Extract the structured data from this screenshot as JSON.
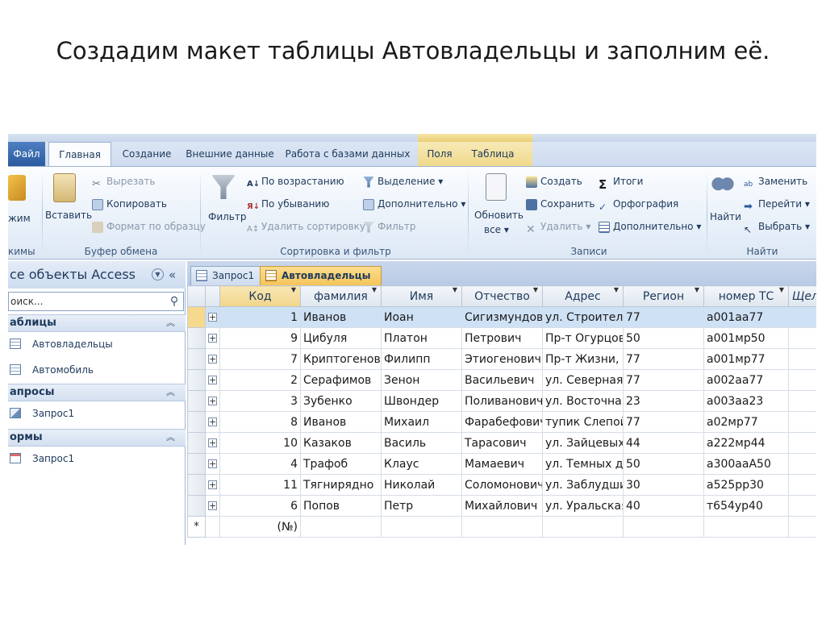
{
  "slide": {
    "title": "Создадим макет таблицы Автовладельцы и заполним её."
  },
  "ribbon": {
    "tabs": [
      "Файл",
      "Главная",
      "Создание",
      "Внешние данные",
      "Работа с базами данных",
      "Поля",
      "Таблица"
    ],
    "views": {
      "label": "жим",
      "group": "кимы"
    },
    "clipboard": {
      "paste": "Вставить",
      "cut": "Вырезать",
      "copy": "Копировать",
      "format_painter": "Формат по образцу",
      "group": "Буфер обмена"
    },
    "sort_filter": {
      "filter": "Фильтр",
      "ascending": "По возрастанию",
      "descending": "По убыванию",
      "remove_sort": "Удалить сортировку",
      "selection": "Выделение",
      "advanced": "Дополнительно",
      "toggle_filter": "Фильтр",
      "group": "Сортировка и фильтр"
    },
    "records": {
      "refresh": "Обновить",
      "refresh_sub": "все",
      "new": "Создать",
      "save": "Сохранить",
      "delete": "Удалить",
      "totals": "Итоги",
      "spelling": "Орфография",
      "more": "Дополнительно",
      "group": "Записи"
    },
    "find": {
      "find": "Найти",
      "replace": "Заменить",
      "goto": "Перейти",
      "select": "Выбрать",
      "group": "Найти"
    }
  },
  "nav": {
    "header": "се объекты Access",
    "search_placeholder": "оиск...",
    "sections": [
      {
        "label": "аблицы",
        "items": [
          "Автовладельцы",
          "Автомобиль"
        ]
      },
      {
        "label": "апросы",
        "items": [
          "Запрос1"
        ]
      },
      {
        "label": "ормы",
        "items": [
          "Запрос1"
        ]
      }
    ]
  },
  "doc_tabs": [
    "Запрос1",
    "Автовладельцы"
  ],
  "table": {
    "columns": [
      "Код",
      "фамилия",
      "Имя",
      "Отчество",
      "Адрес",
      "Регион",
      "номер ТС",
      "Щелк"
    ],
    "rows": [
      [
        "1",
        "Иванов",
        "Иоан",
        "Сигизмундови",
        "ул. Строителе",
        "77",
        "а001аа77"
      ],
      [
        "9",
        "Цибуля",
        "Платон",
        "Петрович",
        "Пр-т Огурцов",
        "50",
        "а001мр50"
      ],
      [
        "7",
        "Криптогенов",
        "Филипп",
        "Этиогенович",
        "Пр-т Жизни, 1",
        "77",
        "а001мр77"
      ],
      [
        "2",
        "Серафимов",
        "Зенон",
        "Васильевич",
        "ул. Северная,",
        "77",
        "а002аа77"
      ],
      [
        "3",
        "Зубенко",
        "Швондер",
        "Поливанович",
        "ул. Восточная,",
        "23",
        "а003аа23"
      ],
      [
        "8",
        "Иванов",
        "Михаил",
        "Фарабефович",
        "тупик Слепой,",
        "77",
        "а02мр77"
      ],
      [
        "10",
        "Казаков",
        "Василь",
        "Тарасович",
        "ул. Зайцевых 1",
        "44",
        "а222мр44"
      ],
      [
        "4",
        "Трафоб",
        "Клаус",
        "Мамаевич",
        "ул. Темных дн",
        "50",
        "а300ааА50"
      ],
      [
        "11",
        "Тягнирядно",
        "Николай",
        "Соломонович",
        "ул. Заблудши",
        "30",
        "а525рр30"
      ],
      [
        "6",
        "Попов",
        "Петр",
        "Михайлович",
        "ул. Уральская,",
        "40",
        "т654ур40"
      ]
    ],
    "new_row_marker": "*",
    "new_row_code": "(№)"
  }
}
